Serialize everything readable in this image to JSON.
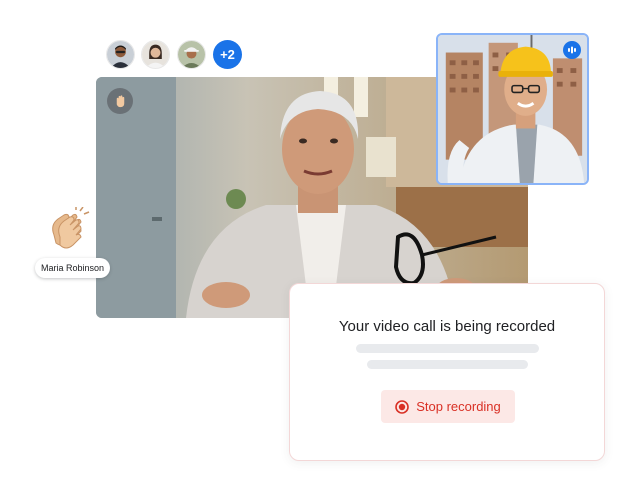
{
  "participants": {
    "avatars": [
      "participant-1",
      "participant-2",
      "participant-3"
    ],
    "more_count": "+2"
  },
  "main_video": {
    "reaction_button_icon": "raised-hand-icon"
  },
  "self_view": {
    "indicator_icon": "audio-levels-icon"
  },
  "reaction": {
    "icon": "clapping-hands-icon",
    "name": "Maria Robinson"
  },
  "recording_card": {
    "title": "Your video call is being recorded",
    "stop_label": "Stop recording",
    "stop_icon": "record-icon"
  },
  "colors": {
    "accent": "#1a73e8",
    "stop_text": "#d93025",
    "stop_bg": "#fce8e6",
    "skeleton": "#e8eaed"
  }
}
